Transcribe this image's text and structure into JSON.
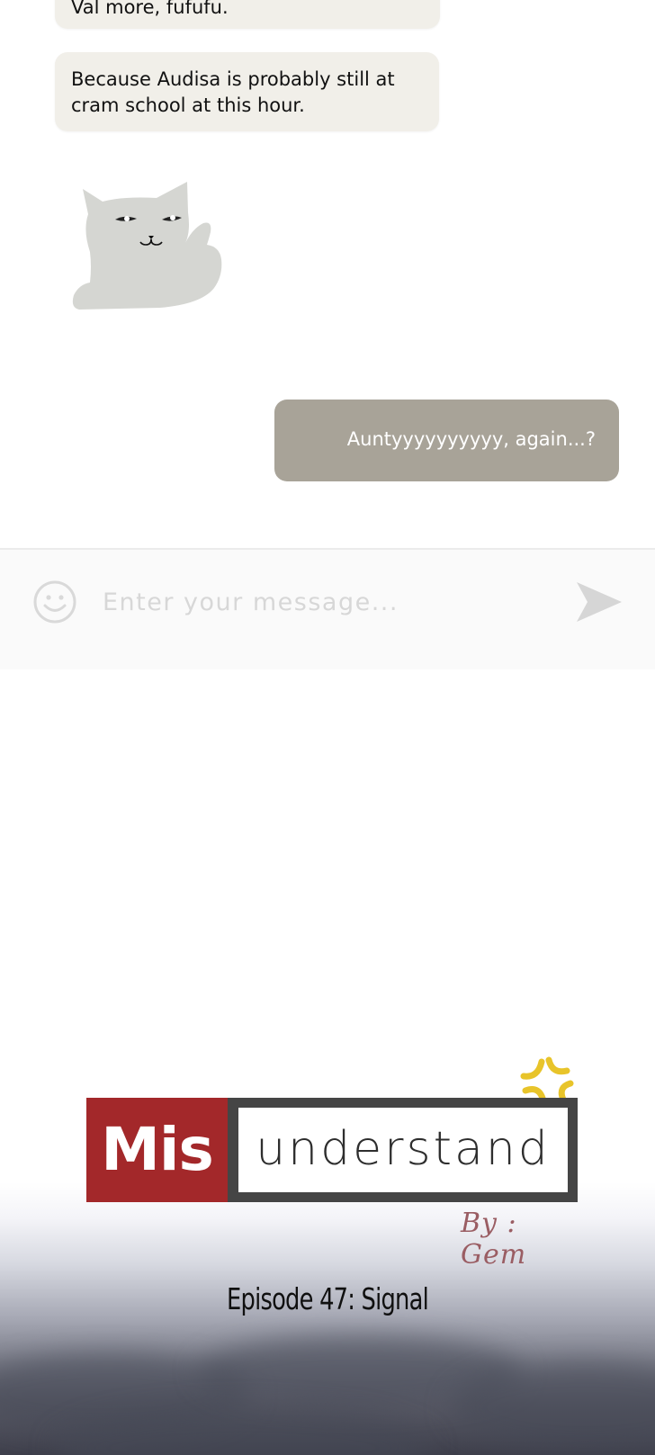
{
  "chat": {
    "messages": [
      {
        "direction": "incoming",
        "text": "Val more, fufufu."
      },
      {
        "direction": "incoming",
        "text": "Because Audisa is probably still at cram school at this hour."
      },
      {
        "direction": "incoming",
        "type": "sticker",
        "icon": "cat-thumbs-up-sticker"
      },
      {
        "direction": "outgoing",
        "text": "Auntyyyyyyyyyy, again...?"
      }
    ]
  },
  "composer": {
    "placeholder": "Enter your message...",
    "value": "",
    "emoji_icon": "smiley-face-icon",
    "send_icon": "send-arrow-icon"
  },
  "cover": {
    "logo_part1": "Mis",
    "logo_part2": "understand",
    "byline": "By : Gem",
    "episode": "Episode 47: Signal",
    "anger_icon": "anger-mark-icon"
  },
  "colors": {
    "incoming_bubble": "#f1efe9",
    "outgoing_bubble": "#a8a398",
    "logo_red": "#a3282a",
    "logo_border": "#454545",
    "anger_yellow": "#e8c42a"
  }
}
